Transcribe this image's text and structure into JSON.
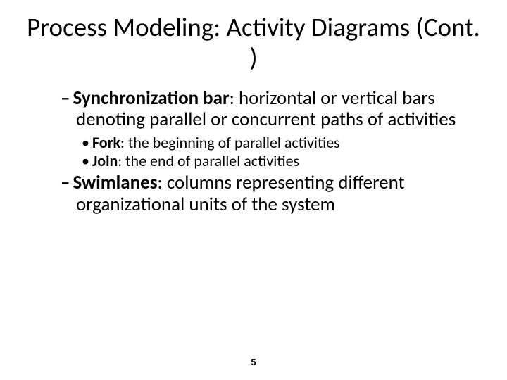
{
  "title": "Process Modeling: Activity Diagrams (Cont. )",
  "items": [
    {
      "term": "Synchronization bar",
      "rest": ": horizontal or vertical bars denoting parallel or concurrent paths of activities",
      "children": [
        {
          "term": "Fork",
          "rest": ": the beginning of parallel activities"
        },
        {
          "term": "Join",
          "rest": ": the end of parallel activities"
        }
      ]
    },
    {
      "term": "Swimlanes",
      "rest": ": columns representing different organizational units of the system",
      "children": []
    }
  ],
  "page": "5",
  "glyphs": {
    "dash": "–",
    "bullet": "•"
  }
}
